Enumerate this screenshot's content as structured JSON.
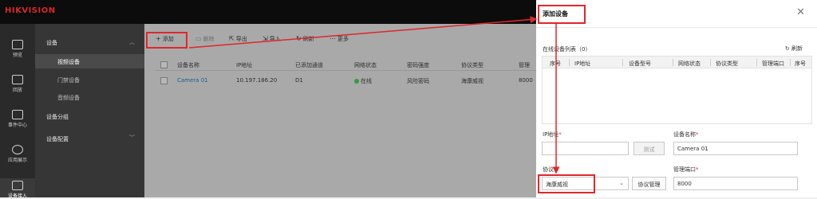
{
  "app": {
    "logo": "HIKVISION"
  },
  "rail": [
    {
      "label": "预览",
      "icon": "monitor-icon"
    },
    {
      "label": "回放",
      "icon": "playback-icon"
    },
    {
      "label": "事件中心",
      "icon": "event-icon"
    },
    {
      "label": "应用展示",
      "icon": "app-icon"
    },
    {
      "label": "设备接入",
      "icon": "device-icon"
    }
  ],
  "nav": {
    "device_group": "设备",
    "video_device": "视频设备",
    "door_device": "门禁设备",
    "audio_device": "音频设备",
    "device_grouping": "设备分组",
    "device_config": "设备配置"
  },
  "toolbar": {
    "add": "添加",
    "delete": "删除",
    "export": "导出",
    "import": "导入",
    "refresh": "刷新",
    "more": "更多"
  },
  "table": {
    "headers": [
      "设备名称",
      "IP地址",
      "已添加通道",
      "网络状态",
      "密码强度",
      "协议类型",
      "管理"
    ],
    "rows": [
      {
        "name": "Camera 01",
        "ip": "10.197.186.20",
        "channels": "D1",
        "status": "在线",
        "password": "风险密码",
        "protocol": "海康威视",
        "port": "8000"
      }
    ]
  },
  "panel": {
    "title": "添加设备",
    "online_list_label": "在线设备列表（0）",
    "refresh": "刷新",
    "list_headers": [
      "序号",
      "IP地址",
      "设备型号",
      "网络状态",
      "协议类型",
      "管理端口",
      "序号"
    ],
    "ip_label": "IP地址",
    "ip_value": "",
    "test_button": "测试",
    "name_label": "设备名称",
    "name_value": "Camera 01",
    "protocol_label": "协议",
    "protocol_value": "海康威视",
    "protocol_mgmt_button": "协议管理",
    "port_label": "管理端口",
    "port_value": "8000",
    "required_mark": "*"
  },
  "colors": {
    "highlight": "#e0262b",
    "link": "#1a5f8c",
    "online": "#2e9e3e"
  }
}
